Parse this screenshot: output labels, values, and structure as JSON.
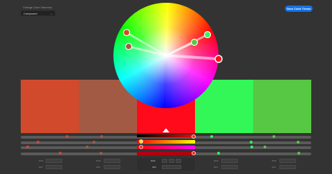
{
  "header": {
    "harmony_label": "Change Color Harmony",
    "harmony_value": "Compound",
    "save_label": "Save Color Theme"
  },
  "colors": {
    "accent": "#1473e6",
    "background": "#333333"
  },
  "swatches": [
    {
      "hex": "#d14a2c",
      "active": false
    },
    {
      "hex": "#a35a45",
      "active": false
    },
    {
      "hex": "#ff0a1a",
      "active": true
    },
    {
      "hex": "#33f757",
      "active": false
    },
    {
      "hex": "#57c843",
      "active": false
    }
  ],
  "wheel": {
    "handles": [
      {
        "color": "#d14a2c",
        "hue_deg": 62
      },
      {
        "color": "#a35a45",
        "hue_deg": 72
      },
      {
        "color": "#ff0a1a",
        "hue_deg": 0
      },
      {
        "color": "#33f757",
        "hue_deg": 150
      },
      {
        "color": "#57c843",
        "hue_deg": 140
      }
    ]
  },
  "footer": {
    "mode_values": [
      "RGB",
      "HSB",
      "Lab"
    ],
    "hex_label": "HEX"
  }
}
